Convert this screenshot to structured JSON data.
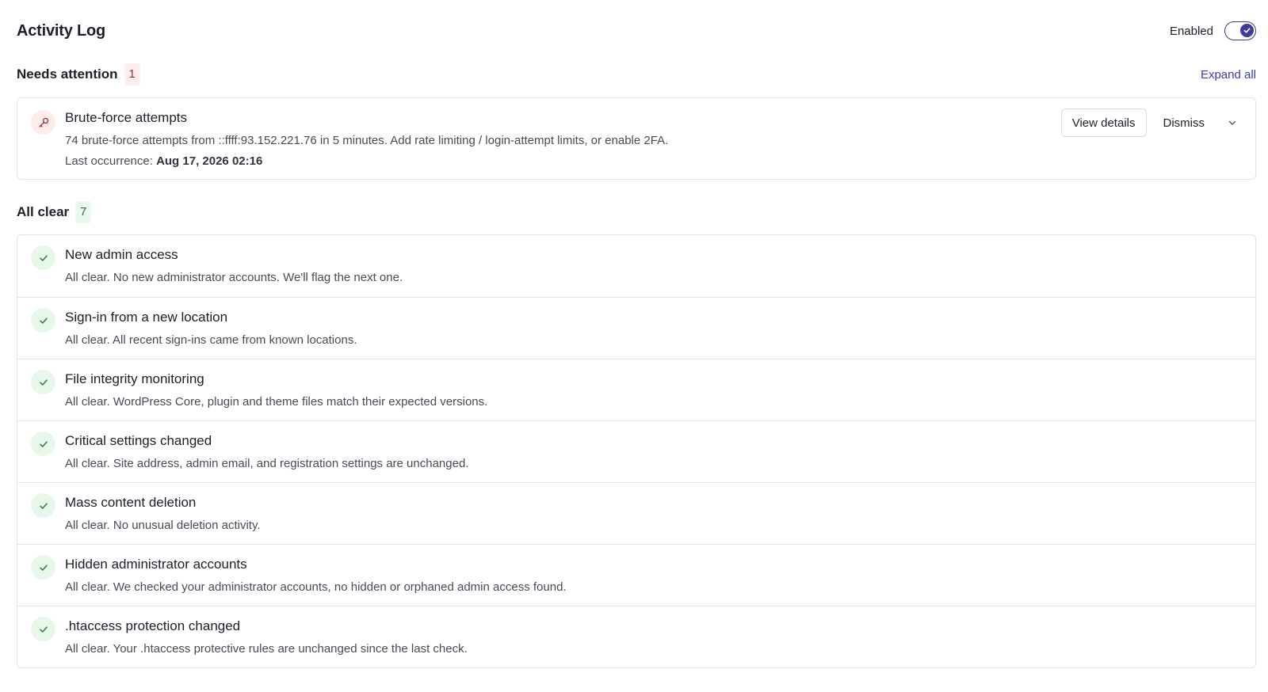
{
  "header": {
    "title": "Activity Log",
    "toggle_label": "Enabled",
    "toggle_on": true
  },
  "needs_attention": {
    "title": "Needs attention",
    "count": "1",
    "expand_label": "Expand all",
    "items": [
      {
        "title": "Brute-force attempts",
        "description": "74 brute-force attempts from ::ffff:93.152.221.76 in 5 minutes. Add rate limiting / login-attempt limits, or enable 2FA.",
        "meta_label": "Last occurrence:",
        "meta_value": "Aug 17, 2026 02:16",
        "view_label": "View details",
        "dismiss_label": "Dismiss",
        "icon": "key-icon"
      }
    ]
  },
  "all_clear": {
    "title": "All clear",
    "count": "7",
    "items": [
      {
        "title": "New admin access",
        "description": "All clear. No new administrator accounts. We'll flag the next one."
      },
      {
        "title": "Sign-in from a new location",
        "description": "All clear. All recent sign-ins came from known locations."
      },
      {
        "title": "File integrity monitoring",
        "description": "All clear. WordPress Core, plugin and theme files match their expected versions."
      },
      {
        "title": "Critical settings changed",
        "description": "All clear. Site address, admin email, and registration settings are unchanged."
      },
      {
        "title": "Mass content deletion",
        "description": "All clear. No unusual deletion activity."
      },
      {
        "title": "Hidden administrator accounts",
        "description": "All clear. We checked your administrator accounts, no hidden or orphaned admin access found."
      },
      {
        "title": ".htaccess protection changed",
        "description": "All clear. Your .htaccess protective rules are unchanged since the last check."
      }
    ]
  },
  "colors": {
    "accent": "#3d3d9e",
    "link": "#3b3bb0",
    "warn_bg": "#fdecea",
    "ok_bg": "#e7f7ea",
    "ok_icon": "#2f7a45"
  }
}
